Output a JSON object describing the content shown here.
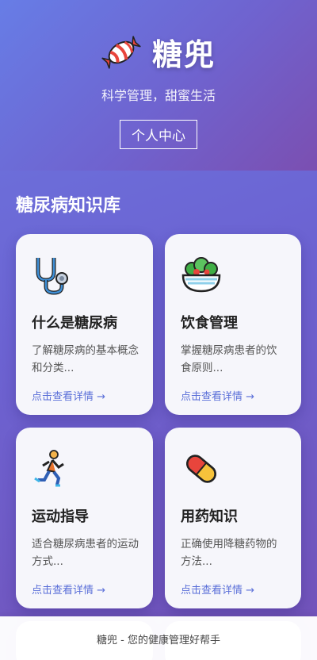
{
  "header": {
    "brand_icon": "candy-icon",
    "title": "糖兜",
    "slogan": "科学管理，甜蜜生活",
    "profile_button": "个人中心"
  },
  "knowledge": {
    "section_title": "糖尿病知识库",
    "cards": [
      {
        "icon": "stethoscope-icon",
        "title": "什么是糖尿病",
        "desc": "了解糖尿病的基本概念和分类...",
        "link": "点击查看详情 →"
      },
      {
        "icon": "salad-icon",
        "title": "饮食管理",
        "desc": "掌握糖尿病患者的饮食原则...",
        "link": "点击查看详情 →"
      },
      {
        "icon": "running-person-icon",
        "title": "运动指导",
        "desc": "适合糖尿病患者的运动方式...",
        "link": "点击查看详情 →"
      },
      {
        "icon": "pill-icon",
        "title": "用药知识",
        "desc": "正确使用降糖药物的方法...",
        "link": "点击查看详情 →"
      }
    ]
  },
  "footer": {
    "text": "糖兜 - 您的健康管理好帮手"
  }
}
